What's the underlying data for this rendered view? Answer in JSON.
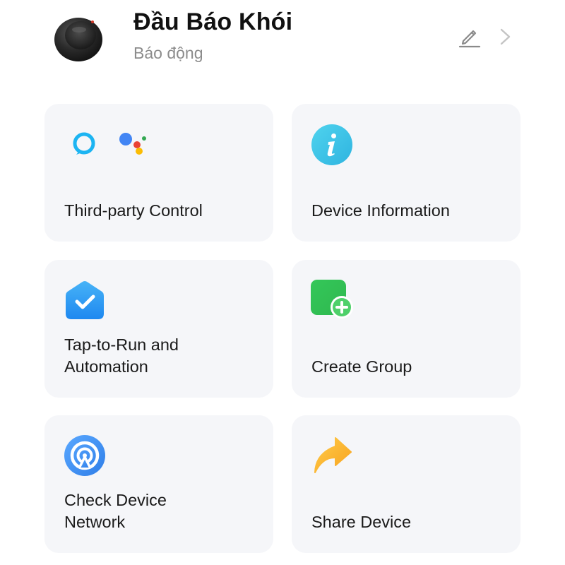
{
  "header": {
    "title": "Đầu Báo Khói",
    "status": "Báo động"
  },
  "actions": {
    "third_party": {
      "label": "Third-party Control",
      "icons": [
        "alexa-icon",
        "google-assistant-icon"
      ]
    },
    "device_info": {
      "label": "Device Information",
      "icon": "info-icon"
    },
    "tap_to_run": {
      "label": "Tap-to-Run and\nAutomation",
      "icon": "automation-check-icon"
    },
    "create_group": {
      "label": "Create Group",
      "icon": "create-group-icon"
    },
    "check_network": {
      "label": "Check Device\nNetwork",
      "icon": "network-signal-icon"
    },
    "share_device": {
      "label": "Share Device",
      "icon": "share-arrow-icon"
    }
  },
  "colors": {
    "card_background": "#f5f6f9",
    "alexa": "#1cb4f2",
    "info": "#38c6e6",
    "automation": "#2196f3",
    "group": "#3ccf5a",
    "network": "#3a8ef0",
    "share": "#f9b233"
  }
}
